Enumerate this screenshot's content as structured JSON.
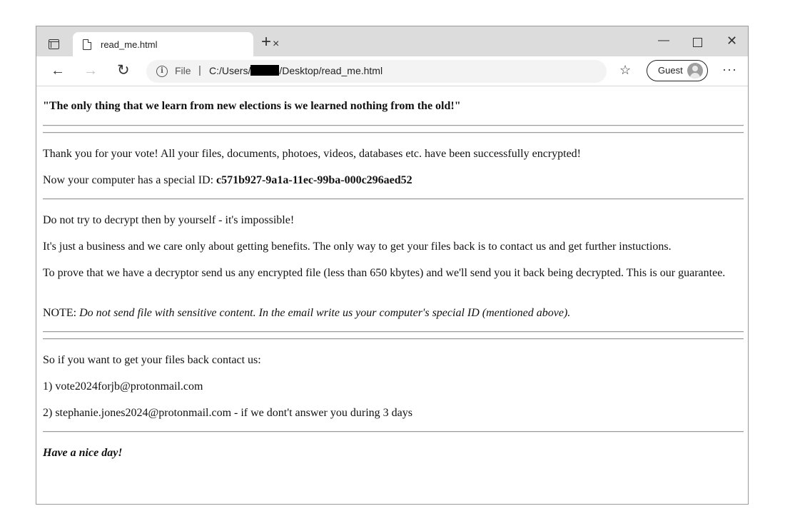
{
  "browser": {
    "tab_title": "read_me.html",
    "tab_close": "×",
    "new_tab": "+",
    "address": {
      "scheme_label": "File",
      "separator": "|",
      "url_prefix": "C:/Users/",
      "url_suffix": "/Desktop/read_me.html"
    },
    "profile_label": "Guest",
    "icons": [
      "tab-actions-icon",
      "page-icon",
      "back-arrow-icon",
      "forward-arrow-icon",
      "refresh-icon",
      "info-icon",
      "favorites-icon",
      "avatar-icon",
      "more-icon"
    ]
  },
  "note": {
    "headline": "\"The only thing that we learn from new elections is we learned nothing from the old!\"",
    "thanks": "Thank you for your vote! All your files, documents, photoes, videos, databases etc. have been successfully encrypted!",
    "id_prefix": "Now your computer has a special ID: ",
    "id_value": "c571b927-9a1a-11ec-99ba-000c296aed52",
    "no_decrypt": "Do not try to decrypt then by yourself - it's impossible!",
    "business": "It's just a business and we care only about getting benefits. The only way to get your files back is to contact us and get further instuctions.",
    "prove": "To prove that we have a decryptor send us any encrypted file (less than 650 kbytes) and we'll send you it back being decrypted. This is our guarantee.",
    "note_label": "NOTE: ",
    "note_text": "Do not send file with sensitive content. In the email write us your computer's special ID (mentioned above).",
    "contact_intro": "So if you want to get your files back contact us:",
    "contact_1": "1) vote2024forjb@protonmail.com",
    "contact_2": "2) stephanie.jones2024@protonmail.com - if we dont't answer you during 3 days",
    "signoff": "Have a nice day!"
  }
}
